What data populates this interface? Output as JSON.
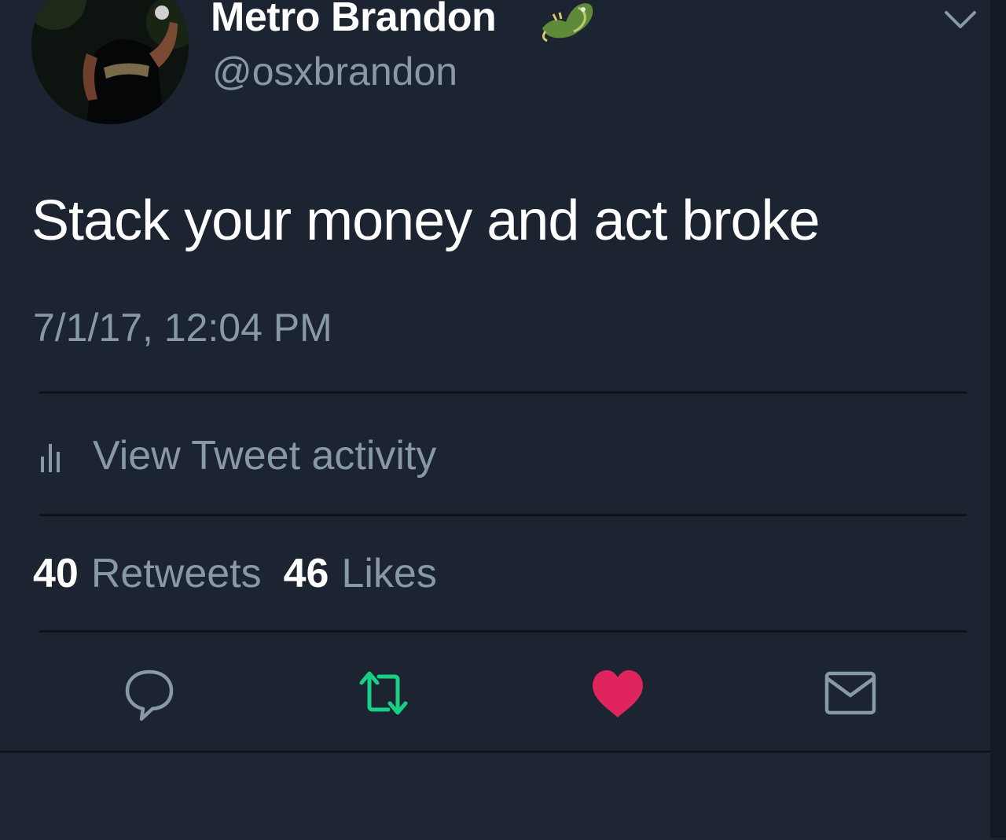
{
  "tweet": {
    "display_name": "Metro Brandon",
    "handle": "@osxbrandon",
    "text": "Stack your money and act broke",
    "timestamp": "7/1/17, 12:04 PM",
    "activity_label": "View Tweet activity",
    "retweets_count": "40",
    "retweets_label": "Retweets",
    "likes_count": "46",
    "likes_label": "Likes",
    "liked": true,
    "retweeted": true
  },
  "icons": {
    "reply": "reply-bubble-icon",
    "retweet": "retweet-icon",
    "like": "heart-icon",
    "dm": "envelope-icon",
    "activity": "bar-chart-icon",
    "more": "chevron-down-icon",
    "name_emoji": "dragon-emoji-icon"
  },
  "colors": {
    "background": "#1c2431",
    "text_primary": "#ffffff",
    "text_secondary": "#8899a6",
    "retweet_active": "#19cf86",
    "like_active": "#e0245e"
  }
}
